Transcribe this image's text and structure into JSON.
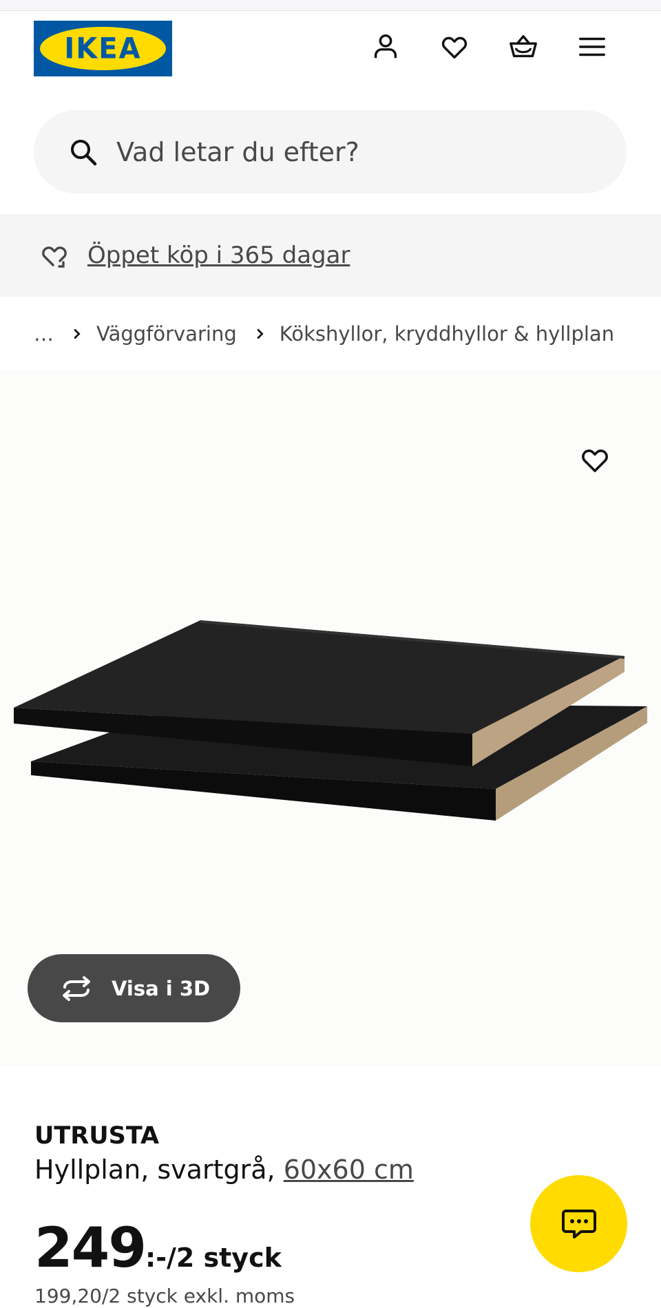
{
  "header": {
    "logo_text": "IKEA",
    "icons": [
      "account-icon",
      "wishlist-heart-icon",
      "cart-basket-icon",
      "menu-hamburger-icon"
    ]
  },
  "search": {
    "placeholder": "Vad letar du efter?",
    "icon": "search-icon"
  },
  "promo": {
    "icon": "return-heart-icon",
    "text": "Öppet köp i 365 dagar"
  },
  "breadcrumb": {
    "ellipsis": "…",
    "items": [
      "Väggförvaring",
      "Kökshyllor, kryddhyllor & hyllplan"
    ]
  },
  "gallery": {
    "favorite_icon": "heart-outline-icon",
    "view_3d_label": "Visa i 3D",
    "view_3d_icon": "rotate-3d-icon"
  },
  "product": {
    "brand": "UTRUSTA",
    "description": "Hyllplan, svartgrå,",
    "measure": "60x60 cm",
    "price_integer": "249",
    "price_suffix": ":-/2 styck",
    "price_excl_vat": "199,20/2 styck exkl. moms"
  },
  "chat": {
    "icon": "chat-bubble-icon"
  },
  "colors": {
    "ikea_blue": "#0058a3",
    "ikea_yellow": "#ffdb00",
    "text_dark": "#111111",
    "text_grey": "#484848",
    "surface_grey": "#f5f5f5"
  }
}
